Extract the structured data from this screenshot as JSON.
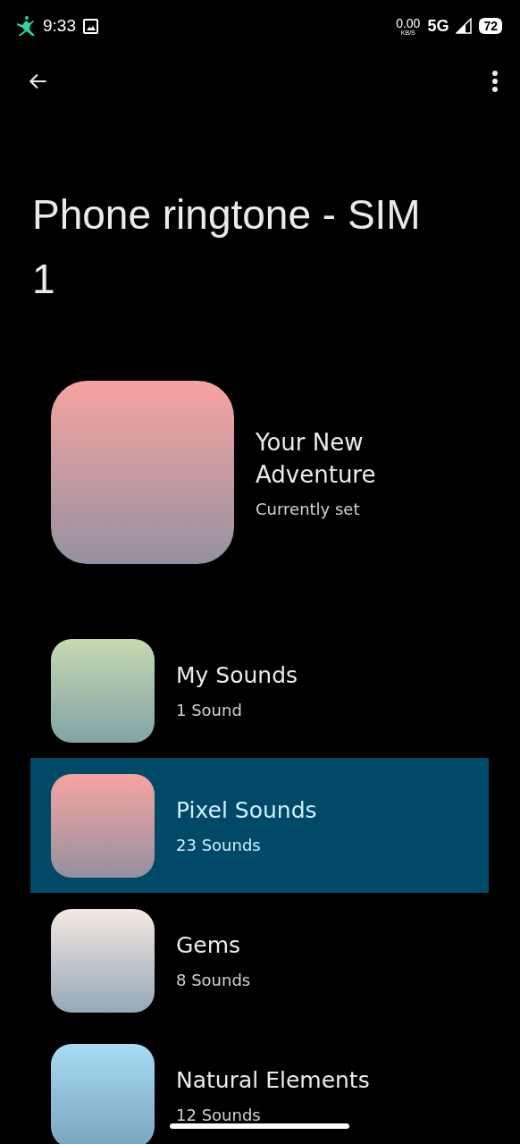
{
  "status_bar": {
    "time": "9:33",
    "speed": "0.00",
    "speed_unit": "KB/S",
    "network": "5G",
    "battery": "72"
  },
  "title": "Phone ringtone - SIM 1",
  "current": {
    "name": "Your New Adventure",
    "subtitle": "Currently set",
    "color": "#f7a3a0"
  },
  "categories": [
    {
      "name": "My Sounds",
      "count": "1 Sound",
      "selected": false,
      "color": "#c6d9b0"
    },
    {
      "name": "Pixel Sounds",
      "count": "23 Sounds",
      "selected": true,
      "color": "#f6a3a0"
    },
    {
      "name": "Gems",
      "count": "8 Sounds",
      "selected": false,
      "color": "#f6e8e2"
    },
    {
      "name": "Natural Elements",
      "count": "12 Sounds",
      "selected": false,
      "color": "#a9dbf5"
    }
  ]
}
